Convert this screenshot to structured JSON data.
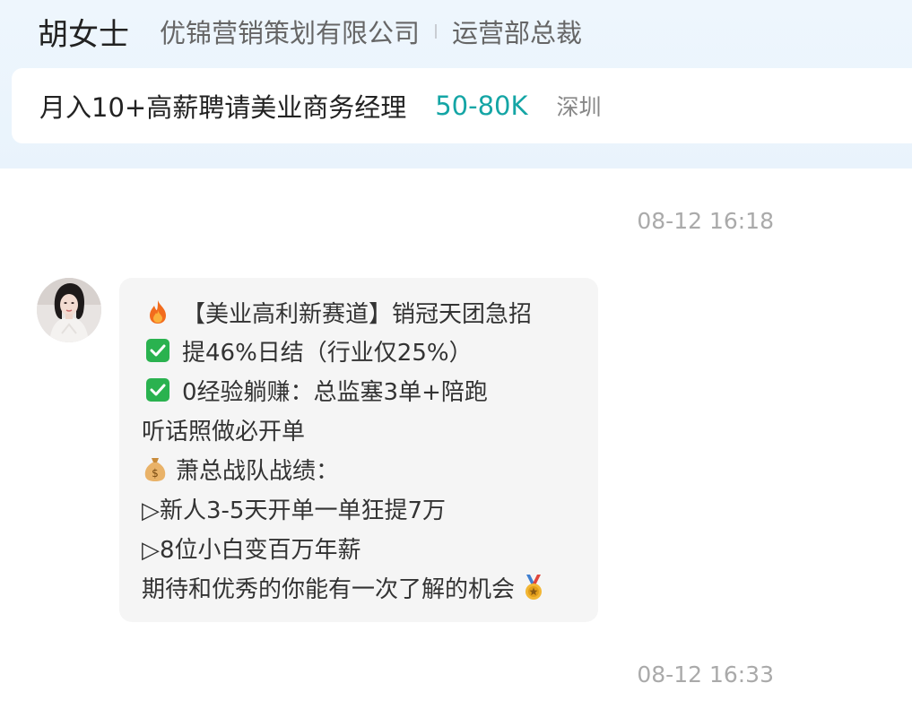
{
  "header": {
    "contact_name": "胡女士",
    "company": "优锦营销策划有限公司",
    "position": "运营部总裁",
    "job": {
      "title": "月入10+高薪聘请美业商务经理",
      "salary": "50-80K",
      "city": "深圳"
    }
  },
  "chat": {
    "timestamp_1": "08-12 16:18",
    "timestamp_2": "08-12 16:33",
    "message": {
      "line1": "【美业高利新赛道】销冠天团急招",
      "line2": "提46%日结（行业仅25%）",
      "line3": "0经验躺赚：总监塞3单+陪跑",
      "line4": "听话照做必开单",
      "line5": "萧总战队战绩：",
      "line6": "▷新人3-5天开单一单狂提7万",
      "line7": "▷8位小白变百万年薪",
      "line8": "期待和优秀的你能有一次了解的机会"
    },
    "icons": {
      "line1": "fire-icon",
      "line2": "check-box-icon",
      "line3": "check-box-icon",
      "line5": "money-bag-icon",
      "line8": "medal-icon"
    }
  },
  "colors": {
    "salary": "#14a5a5",
    "header_bg": "#eaf4fc",
    "bubble_bg": "#f5f5f5",
    "check": "#2ab24f"
  }
}
